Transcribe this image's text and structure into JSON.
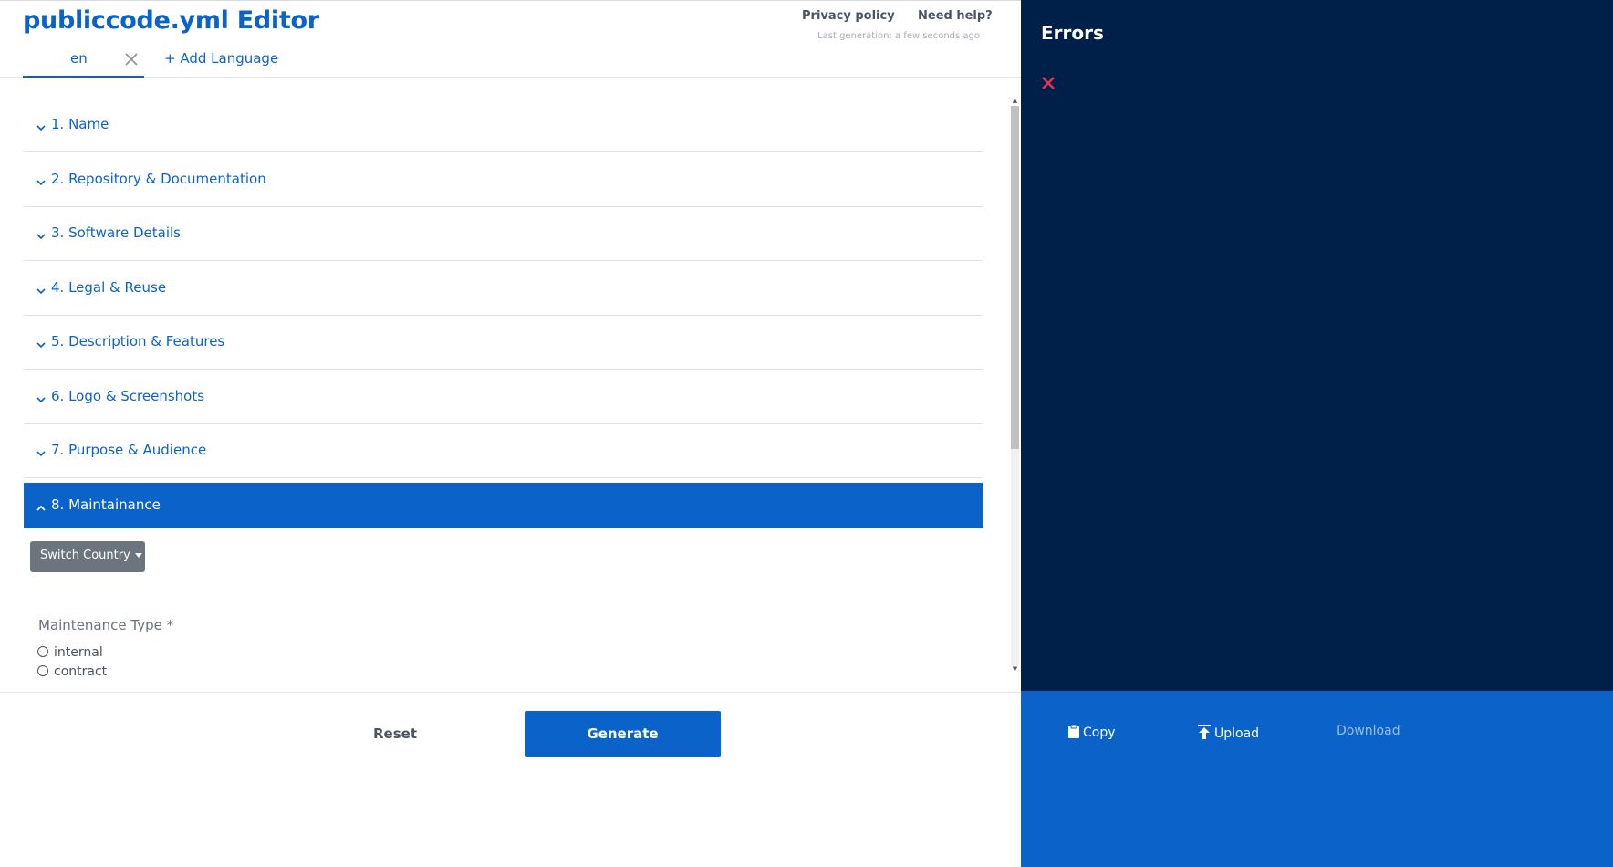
{
  "header": {
    "title": "publiccode.yml Editor",
    "language_tab": "en",
    "add_language": "+ Add Language",
    "privacy_policy": "Privacy policy",
    "need_help": "Need help?",
    "last_generation": "Last generation: a few seconds ago"
  },
  "sections": [
    {
      "label": "1. Name",
      "expanded": false
    },
    {
      "label": "2. Repository & Documentation",
      "expanded": false
    },
    {
      "label": "3. Software Details",
      "expanded": false
    },
    {
      "label": "4. Legal & Reuse",
      "expanded": false
    },
    {
      "label": "5. Description & Features",
      "expanded": false
    },
    {
      "label": "6. Logo & Screenshots",
      "expanded": false
    },
    {
      "label": "7. Purpose & Audience",
      "expanded": false
    },
    {
      "label": "8. Maintainance",
      "expanded": true
    }
  ],
  "maintenance": {
    "switch_country": "Switch Country",
    "type_label": "Maintenance Type *",
    "options": [
      "internal",
      "contract"
    ]
  },
  "footer": {
    "reset": "Reset",
    "generate": "Generate"
  },
  "sidebar": {
    "title": "Errors",
    "actions": {
      "copy": "Copy",
      "upload": "Upload",
      "download": "Download"
    }
  },
  "colors": {
    "accent": "#0b63c9",
    "sidebar_bg": "#00204a",
    "error_icon": "#e8344e",
    "button_gray": "#6c757d"
  },
  "icons": [
    "close-icon",
    "chevron-down-icon",
    "chevron-up-icon",
    "caret-down-icon",
    "clipboard-icon",
    "upload-icon"
  ]
}
